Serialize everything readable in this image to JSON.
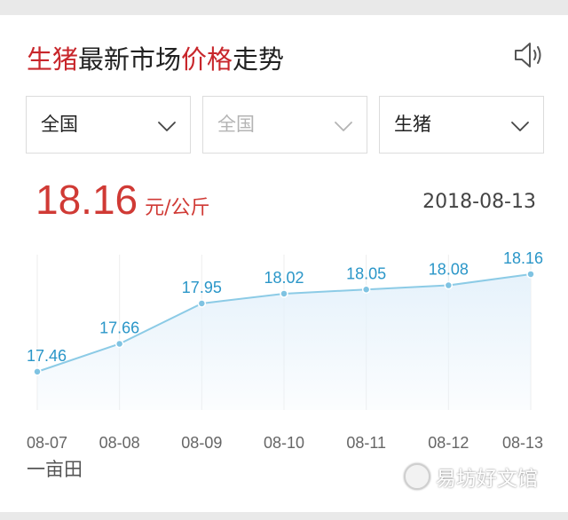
{
  "header": {
    "title_parts": [
      {
        "text": "生猪",
        "highlight": true
      },
      {
        "text": "最新市场",
        "highlight": false
      },
      {
        "text": "价格",
        "highlight": true
      },
      {
        "text": "走势",
        "highlight": false
      }
    ],
    "speaker_icon": "speaker-icon"
  },
  "filters": [
    {
      "value": "全国",
      "disabled": false
    },
    {
      "value": "全国",
      "disabled": true
    },
    {
      "value": "生猪",
      "disabled": false
    }
  ],
  "price": {
    "value": "18.16",
    "unit": "元/公斤"
  },
  "date": "2018-08-13",
  "chart_data": {
    "type": "area",
    "categories": [
      "08-07",
      "08-08",
      "08-09",
      "08-10",
      "08-11",
      "08-12",
      "08-13"
    ],
    "values": [
      17.46,
      17.66,
      17.95,
      18.02,
      18.05,
      18.08,
      18.16
    ],
    "title": "",
    "xlabel": "",
    "ylabel": "",
    "ylim": [
      17.3,
      18.3
    ],
    "grid": true,
    "legend": "none",
    "colors": {
      "line": "#8ccbe6",
      "point": "#7fc3e2",
      "fill": "#e6f2fb",
      "label": "#2a96c8",
      "grid": "#eeeeee"
    }
  },
  "footer": {
    "source": "一亩田"
  },
  "watermark": {
    "text": "易坊好文馆"
  },
  "colors": {
    "accent_red": "#c8262b",
    "price_red": "#d03a35"
  }
}
